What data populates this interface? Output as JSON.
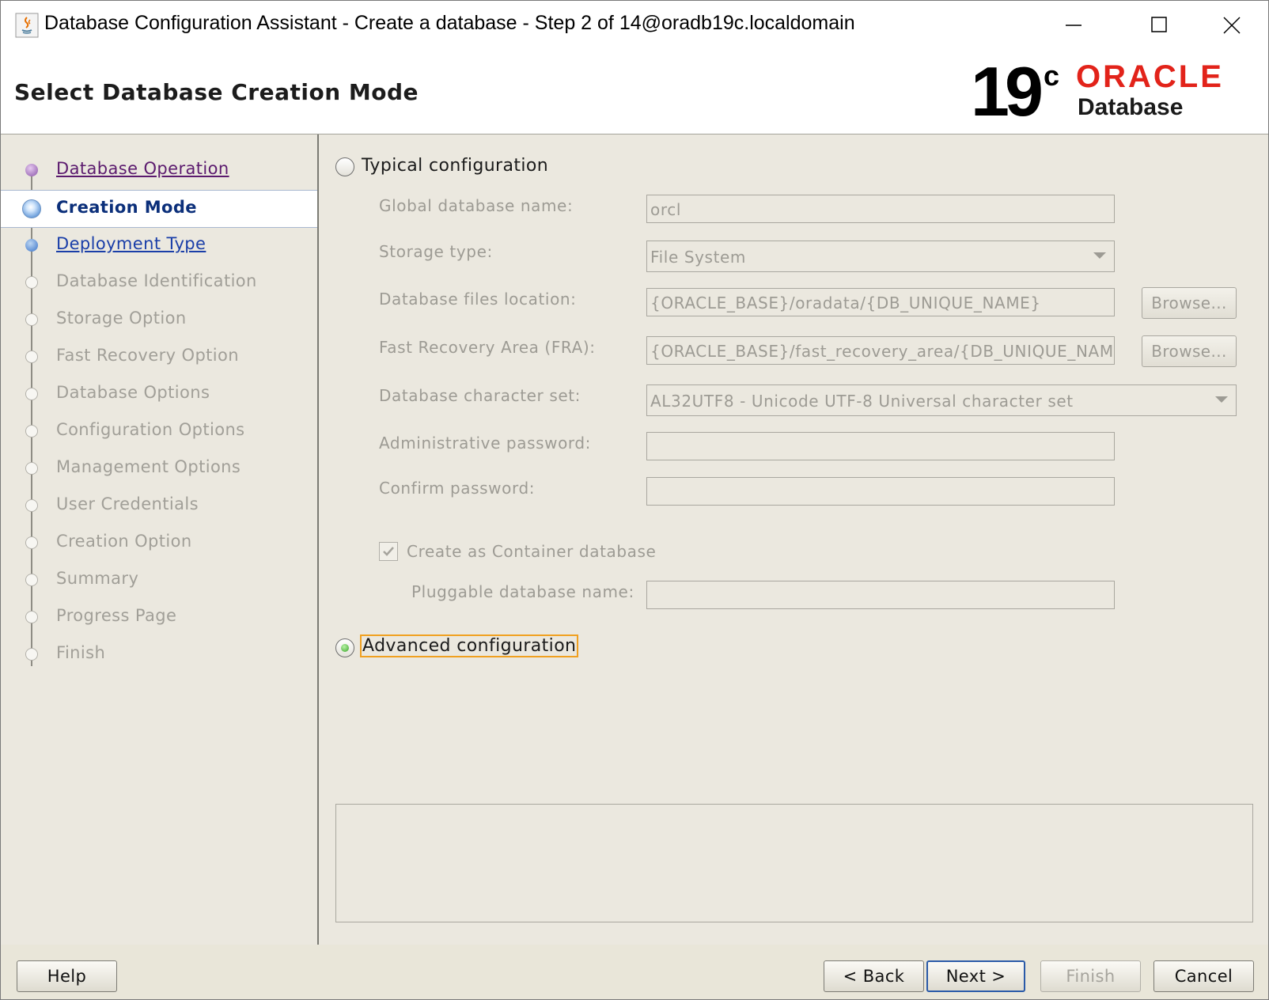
{
  "window": {
    "title": "Database Configuration Assistant - Create a database - Step 2 of 14@oradb19c.localdomain",
    "icon": "java-icon",
    "controls": [
      "minimize",
      "maximize",
      "close"
    ]
  },
  "header": {
    "title": "Select Database Creation Mode",
    "logo": {
      "version": "19",
      "version_sup": "c",
      "brand": "ORACLE",
      "product": "Database",
      "brand_color": "#e2231a"
    }
  },
  "nav": {
    "items": [
      {
        "label": "Database Operation",
        "state": "visited"
      },
      {
        "label": "Creation Mode",
        "state": "current"
      },
      {
        "label": "Deployment Type",
        "state": "link"
      },
      {
        "label": "Database Identification",
        "state": "disabled"
      },
      {
        "label": "Storage Option",
        "state": "disabled"
      },
      {
        "label": "Fast Recovery Option",
        "state": "disabled"
      },
      {
        "label": "Database Options",
        "state": "disabled"
      },
      {
        "label": "Configuration Options",
        "state": "disabled"
      },
      {
        "label": "Management Options",
        "state": "disabled"
      },
      {
        "label": "User Credentials",
        "state": "disabled"
      },
      {
        "label": "Creation Option",
        "state": "disabled"
      },
      {
        "label": "Summary",
        "state": "disabled"
      },
      {
        "label": "Progress Page",
        "state": "disabled"
      },
      {
        "label": "Finish",
        "state": "disabled"
      }
    ]
  },
  "typical": {
    "label": "Typical configuration",
    "selected": false,
    "global_db_name_label": "Global database name:",
    "global_db_name_value": "orcl",
    "storage_type_label": "Storage type:",
    "storage_type_value": "File System",
    "db_files_location_label": "Database files location:",
    "db_files_location_value": "{ORACLE_BASE}/oradata/{DB_UNIQUE_NAME}",
    "fra_label": "Fast Recovery Area (FRA):",
    "fra_value": "{ORACLE_BASE}/fast_recovery_area/{DB_UNIQUE_NAME}",
    "browse_label": "Browse...",
    "charset_label": "Database character set:",
    "charset_value": "AL32UTF8 - Unicode UTF-8 Universal character set",
    "admin_password_label": "Administrative password:",
    "admin_password_value": "",
    "confirm_password_label": "Confirm password:",
    "confirm_password_value": "",
    "container_db_label": "Create as Container database",
    "container_db_checked": true,
    "pdb_name_label": "Pluggable database name:",
    "pdb_name_value": ""
  },
  "advanced": {
    "label": "Advanced configuration",
    "selected": true
  },
  "buttons": {
    "help": "Help",
    "back": "< Back",
    "next": "Next >",
    "finish": "Finish",
    "cancel": "Cancel"
  }
}
